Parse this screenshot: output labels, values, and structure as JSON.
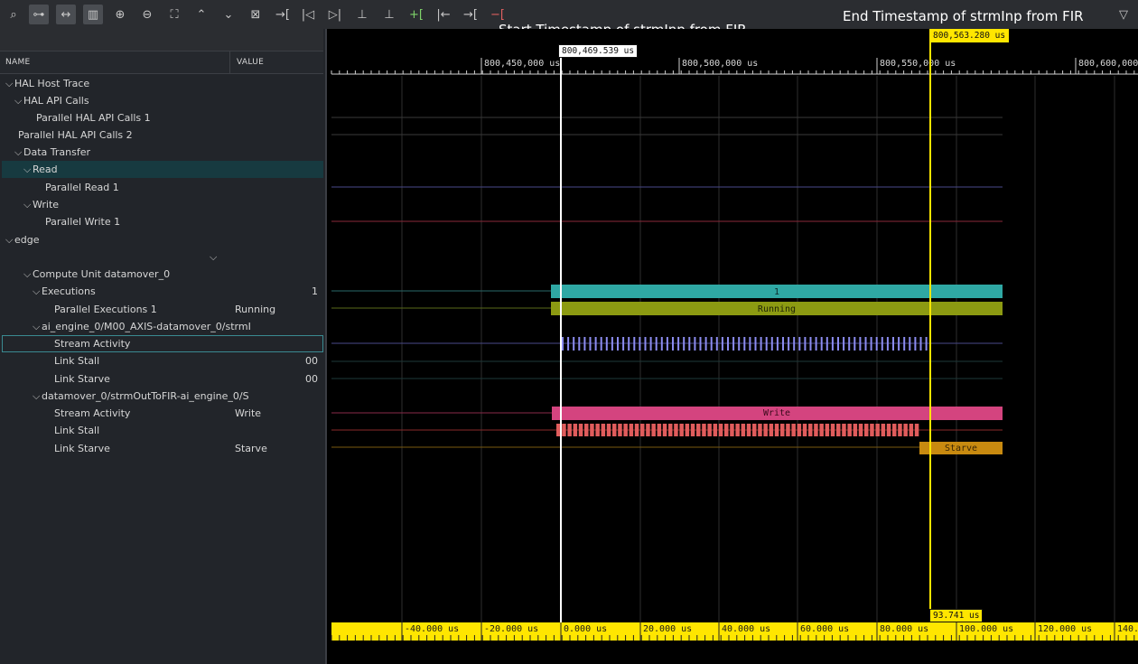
{
  "toolbar": {
    "buttons": [
      {
        "icon": "search-icon",
        "glyph": "⌕"
      },
      {
        "icon": "hierarchy-icon",
        "glyph": "⊶",
        "active": true
      },
      {
        "icon": "fit-width-icon",
        "glyph": "↔",
        "active": true
      },
      {
        "icon": "columns-icon",
        "glyph": "▥",
        "active": true
      },
      {
        "icon": "zoom-in-icon",
        "glyph": "⊕"
      },
      {
        "icon": "zoom-out-icon",
        "glyph": "⊖"
      },
      {
        "icon": "zoom-fit-icon",
        "glyph": "⛶"
      },
      {
        "icon": "collapse-all-icon",
        "glyph": "⌃"
      },
      {
        "icon": "expand-all-icon",
        "glyph": "⌄"
      },
      {
        "icon": "remove-icon",
        "glyph": "⊠"
      },
      {
        "icon": "add-marker-icon",
        "glyph": "→["
      },
      {
        "icon": "previous-edge-icon",
        "glyph": "|◁"
      },
      {
        "icon": "next-edge-icon",
        "glyph": "▷|"
      },
      {
        "icon": "snap-left-icon",
        "glyph": "⊥"
      },
      {
        "icon": "snap-right-icon",
        "glyph": "⊥"
      },
      {
        "icon": "add-green-marker-icon",
        "glyph": "+[",
        "color": "green"
      },
      {
        "icon": "go-to-start-icon",
        "glyph": "|←"
      },
      {
        "icon": "go-to-marker-icon",
        "glyph": "→["
      },
      {
        "icon": "delete-marker-icon",
        "glyph": "−[",
        "color": "red"
      }
    ],
    "filter_icon": "filter-icon"
  },
  "annotations": {
    "start": "Start Timestamp of strmInp from FIR",
    "end": "End Timestamp of strmInp from FIR"
  },
  "columns": {
    "name": "NAME",
    "value": "VALUE"
  },
  "tree": [
    {
      "label": "HAL Host Trace",
      "chevron": true
    },
    {
      "label": "HAL API Calls",
      "chevron": true
    },
    {
      "label": "Parallel HAL API Calls 1"
    },
    {
      "label": "Parallel HAL API Calls 2"
    },
    {
      "label": "Data Transfer",
      "chevron": true
    },
    {
      "label": "Read",
      "chevron": true,
      "selected": true
    },
    {
      "label": "Parallel Read 1"
    },
    {
      "label": "Write",
      "chevron": true
    },
    {
      "label": "Parallel Write 1"
    },
    {
      "label": "edge",
      "chevron": true
    },
    {
      "label": "",
      "lone_chevron": true
    },
    {
      "label": "Compute Unit datamover_0",
      "chevron": true
    },
    {
      "label": "Executions",
      "chevron": true,
      "num": "1"
    },
    {
      "label": "Parallel Executions 1",
      "value": "Running"
    },
    {
      "label": "ai_engine_0/M00_AXIS-datamover_0/strmI",
      "chevron": true
    },
    {
      "label": "Stream Activity",
      "outlined": true
    },
    {
      "label": "Link Stall",
      "num": "00"
    },
    {
      "label": "Link Starve",
      "num": "00"
    },
    {
      "label": "datamover_0/strmOutToFIR-ai_engine_0/S",
      "chevron": true
    },
    {
      "label": "Stream Activity",
      "value": "Write"
    },
    {
      "label": "Link Stall"
    },
    {
      "label": "Link Starve",
      "value": "Starve"
    }
  ],
  "timeline": {
    "top_ticks": [
      "800,450,000 us",
      "800,500,000 us",
      "800,550,000 us",
      "800,600,000"
    ],
    "start_marker": "800,469.539 us",
    "end_marker": "800,563.280 us",
    "bottom_ticks": [
      "-40.000 us",
      "-20.000 us",
      "0.000 us",
      "20.000 us",
      "40.000 us",
      "60.000 us",
      "80.000 us",
      "100.000 us",
      "120.000 us",
      "140."
    ],
    "delta": "93.741 us"
  },
  "bars": {
    "executions": "1",
    "running": "Running",
    "write": "Write",
    "starve": "Starve"
  },
  "colors": {
    "teal": "#2fa8a4",
    "olive": "#8c9a12",
    "stream": "#8c8cf0",
    "pink": "#d4447f",
    "stall": "#e05c5c",
    "starve": "#c88a10",
    "marker": "#ffe600"
  }
}
